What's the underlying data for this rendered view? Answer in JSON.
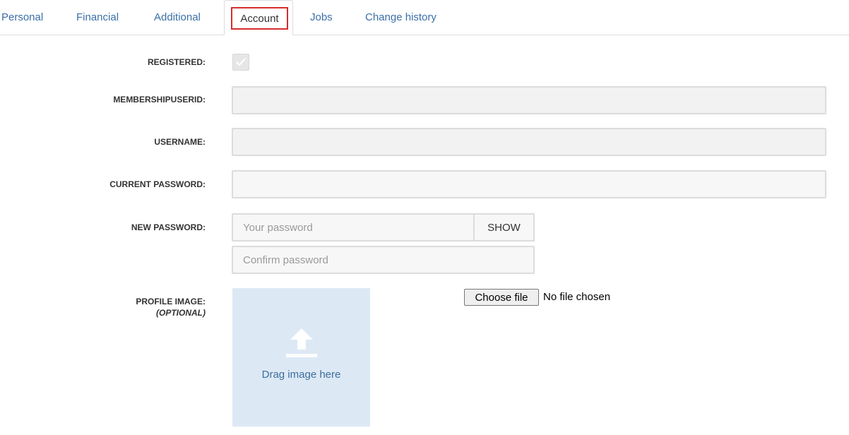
{
  "tabs": [
    {
      "label": "Personal"
    },
    {
      "label": "Financial"
    },
    {
      "label": "Additional"
    },
    {
      "label": "Account"
    },
    {
      "label": "Jobs"
    },
    {
      "label": "Change history"
    }
  ],
  "active_tab": "Account",
  "form": {
    "registered_label": "REGISTERED:",
    "registered_checked": true,
    "membership_label": "MEMBERSHIPUSERID:",
    "membership_value": "",
    "username_label": "USERNAME:",
    "username_value": "",
    "current_password_label": "CURRENT PASSWORD:",
    "current_password_value": "",
    "new_password_label": "NEW PASSWORD:",
    "new_password_placeholder": "Your password",
    "show_label": "SHOW",
    "confirm_password_placeholder": "Confirm password",
    "profile_image_label": "PROFILE IMAGE:",
    "profile_image_optional": "(OPTIONAL)",
    "dropzone_text": "Drag image here",
    "upload_icon": "upload-arrow-icon",
    "choose_file_label": "Choose file",
    "file_status": "No file chosen"
  },
  "colors": {
    "link": "#3c6fa8",
    "active_outline": "#d62d2d",
    "dropzone_bg": "#dce9f5"
  }
}
